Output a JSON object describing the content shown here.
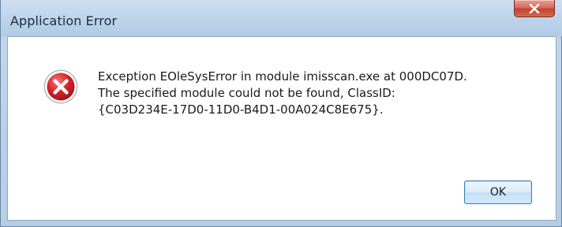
{
  "window": {
    "title": "Application Error"
  },
  "dialog": {
    "icon": "error-x-icon",
    "message_lines": [
      "Exception EOleSysError in module imisscan.exe at 000DC07D.",
      "The specified module could not be found, ClassID:",
      "{C03D234E-17D0-11D0-B4D1-00A024C8E675}."
    ],
    "ok_label": "OK"
  },
  "colors": {
    "error_red": "#d8262b",
    "close_button": "#c34431",
    "button_border": "#3c7fb1"
  }
}
